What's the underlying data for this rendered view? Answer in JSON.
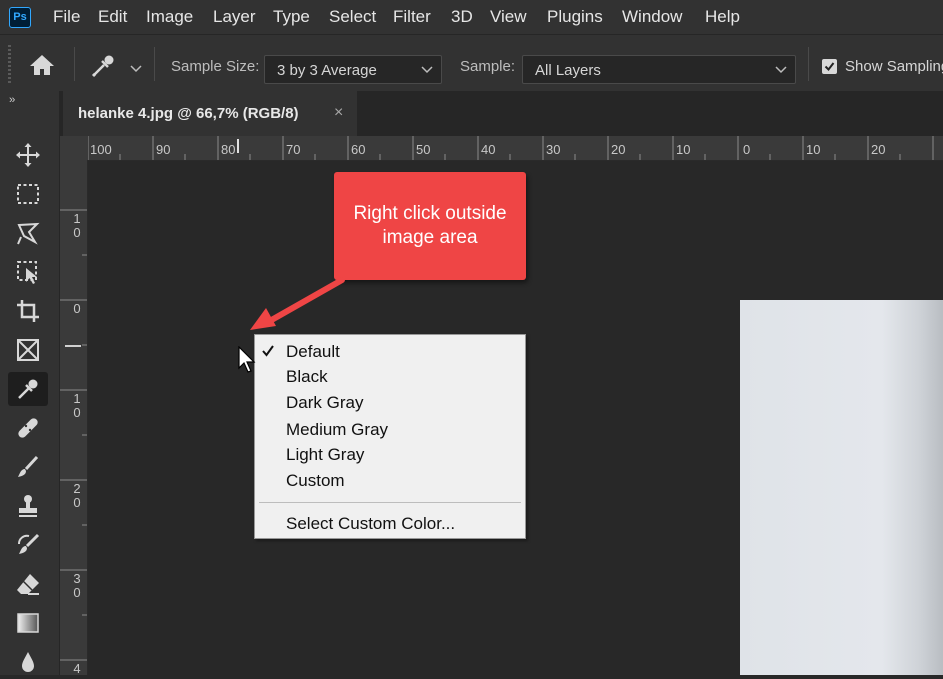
{
  "app": {
    "logo": "Ps"
  },
  "menu": [
    "File",
    "Edit",
    "Image",
    "Layer",
    "Type",
    "Select",
    "Filter",
    "3D",
    "View",
    "Plugins",
    "Window",
    "Help"
  ],
  "options_bar": {
    "sample_size_label": "Sample Size:",
    "sample_size_value": "3 by 3 Average",
    "sample_label": "Sample:",
    "sample_value": "All Layers",
    "show_sampling_label": "Show Sampling",
    "show_sampling_checked": true
  },
  "toolbar": {
    "collapse": "››",
    "tools": [
      "move-icon",
      "marquee-icon",
      "lasso-icon",
      "object-select-icon",
      "crop-icon",
      "frame-icon",
      "eyedropper-icon",
      "healing-brush-icon",
      "brush-icon",
      "clone-stamp-icon",
      "history-brush-icon",
      "eraser-icon",
      "gradient-icon",
      "blur-icon"
    ],
    "active": "eyedropper-icon"
  },
  "document_tab": {
    "title": "helanke 4.jpg @ 66,7% (RGB/8)",
    "close": "×"
  },
  "ruler": {
    "horizontal": [
      "100",
      "90",
      "80",
      "70",
      "60",
      "50",
      "40",
      "30",
      "20",
      "10",
      "0",
      "10",
      "20"
    ],
    "vertical": [
      [
        "1",
        "0"
      ],
      [
        "0"
      ],
      [
        "1",
        "0"
      ],
      [
        "2",
        "0"
      ],
      [
        "3",
        "0"
      ],
      [
        "4"
      ]
    ]
  },
  "callout": {
    "line1": "Right click outside",
    "line2": "image area",
    "color": "#ef4545"
  },
  "context_menu": {
    "items": [
      "Default",
      "Black",
      "Dark Gray",
      "Medium Gray",
      "Light Gray",
      "Custom"
    ],
    "checked": "Default",
    "footer_item": "Select Custom Color..."
  }
}
